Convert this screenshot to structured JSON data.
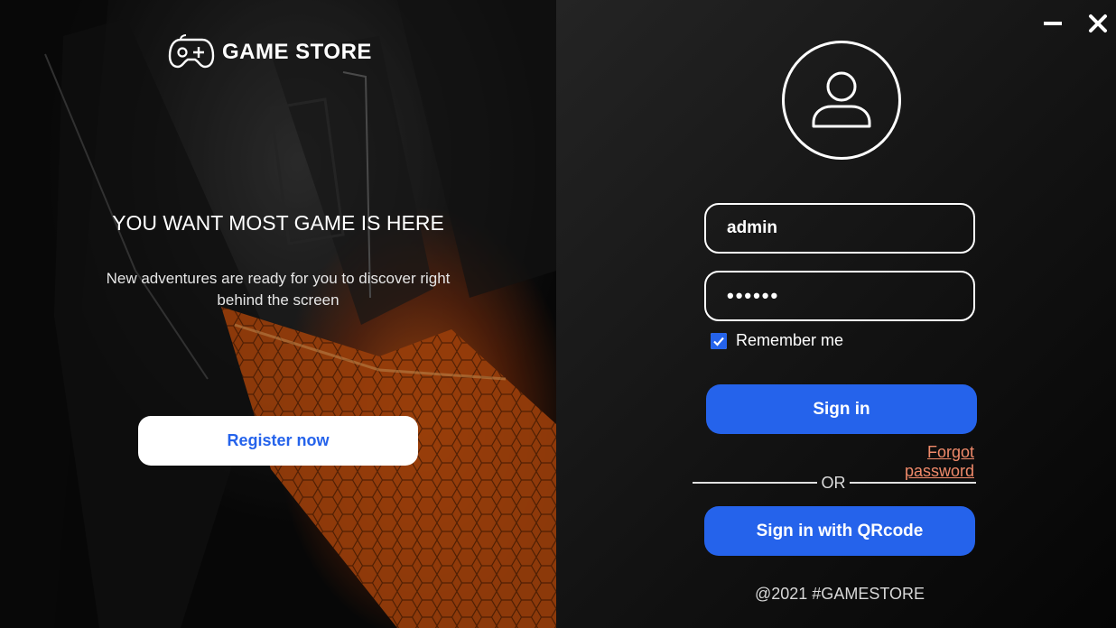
{
  "brand": {
    "name": "GAME STORE",
    "logo_icon": "gamepad-icon"
  },
  "promo": {
    "headline": "YOU WANT MOST GAME IS HERE",
    "tagline": "New adventures are ready for you to discover right behind the screen",
    "register_label": "Register now"
  },
  "window": {
    "minimize_icon": "minimize-icon",
    "close_icon": "close-icon"
  },
  "login": {
    "avatar_icon": "user-icon",
    "username_value": "admin",
    "password_value": "••••••",
    "remember_label": "Remember me",
    "remember_checked": true,
    "signin_label": "Sign in",
    "forgot_label": "Forgot password",
    "or_label": "OR",
    "qr_label": "Sign in with QRcode"
  },
  "footer": {
    "text": "@2021 #GAMESTORE"
  },
  "colors": {
    "accent": "#2563eb",
    "link": "#f08a6a",
    "panel": "#121212"
  }
}
